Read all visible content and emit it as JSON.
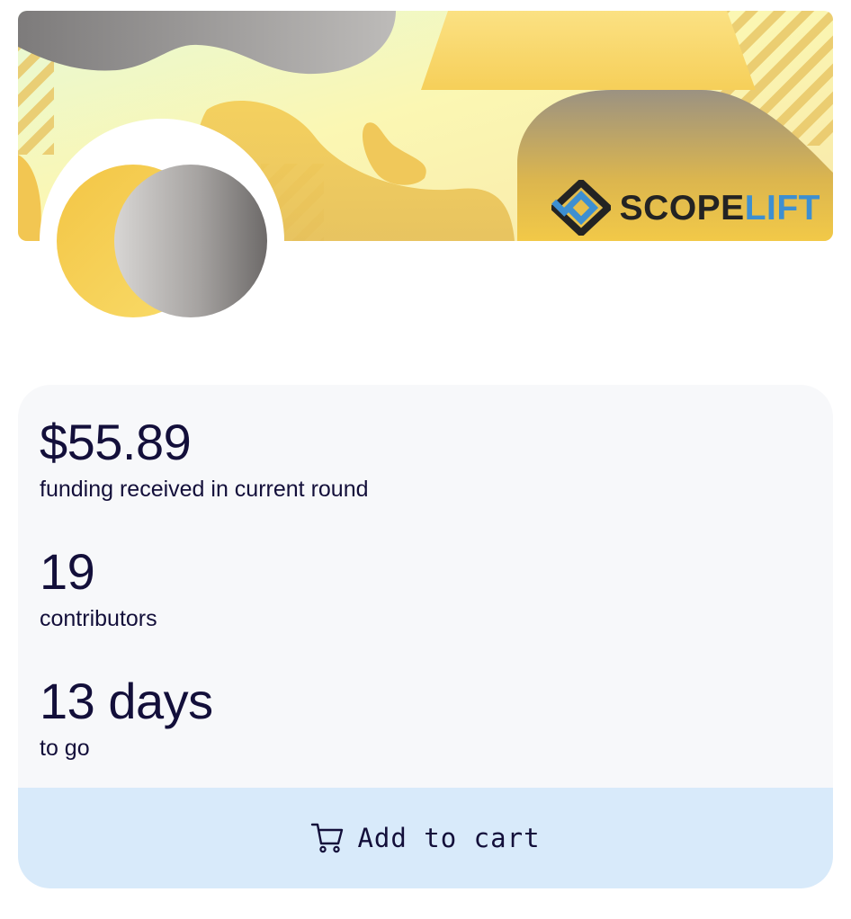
{
  "banner": {
    "brand_left": "SCOPE",
    "brand_right": "LIFT",
    "brand_logo_icon": "scopelift-logo-icon"
  },
  "avatar": {
    "icon": "project-logo-icon"
  },
  "stats": {
    "funding": {
      "value": "$55.89",
      "label": "funding received in current round"
    },
    "contributors": {
      "value": "19",
      "label": "contributors"
    },
    "time_left": {
      "value": "13 days",
      "label": "to go"
    }
  },
  "cart": {
    "icon": "cart-icon",
    "label": "Add to cart"
  },
  "colors": {
    "accent_yellow": "#f5cf55",
    "brand_blue": "#3d8fd1",
    "text_dark": "#130f3a",
    "card_bg": "#f7f8fa",
    "button_bg": "#d8eafa"
  }
}
